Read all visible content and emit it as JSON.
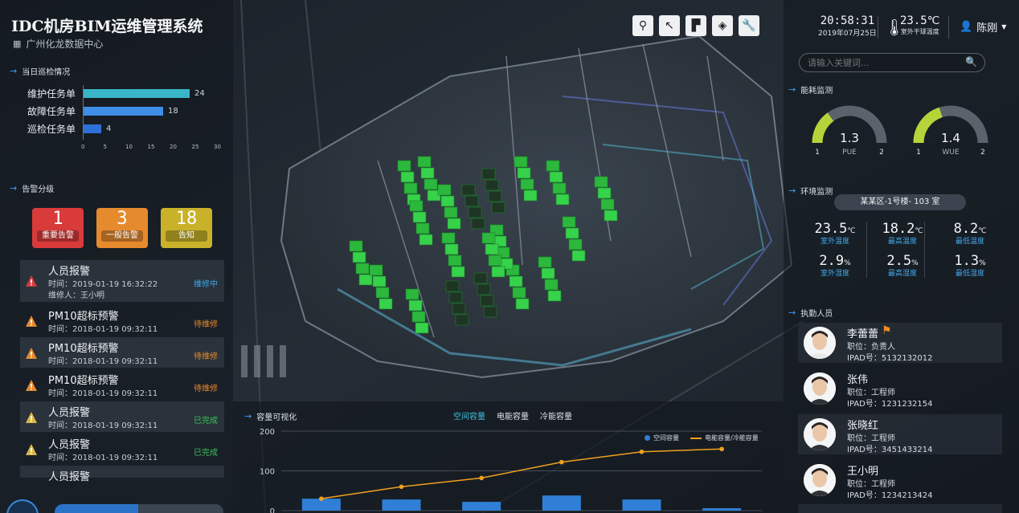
{
  "header": {
    "title": "IDC机房BIM运维管理系统",
    "subtitle": "广州化龙数据中心",
    "time": "20:58:31",
    "date": "2019年07月25日",
    "temperature": "23.5℃",
    "temperature_label": "室外干球温度",
    "user": "陈刚"
  },
  "toolbar": {
    "icons": [
      "location-icon",
      "cursor-icon",
      "paint-roller-icon",
      "layers-icon",
      "wrench-icon"
    ]
  },
  "search": {
    "placeholder": "请输入关键词..."
  },
  "patrol": {
    "title": "当日巡检情况",
    "bars": [
      {
        "label": "维护任务单",
        "value": 24,
        "color": "#39b6c8"
      },
      {
        "label": "故障任务单",
        "value": 18,
        "color": "#3f8ee6"
      },
      {
        "label": "巡检任务单",
        "value": 4,
        "color": "#2f6fd8"
      }
    ],
    "ticks": [
      "0",
      "5",
      "10",
      "15",
      "20",
      "25",
      "30"
    ]
  },
  "alarm_levels": {
    "title": "告警分级",
    "items": [
      {
        "count": "1",
        "label": "重要告警",
        "color": "#d93a3a"
      },
      {
        "count": "3",
        "label": "一般告警",
        "color": "#e68a2e"
      },
      {
        "count": "18",
        "label": "告知",
        "color": "#c9b22a"
      }
    ]
  },
  "alarms": [
    {
      "title": "人员报警",
      "time": "时间：2019-01-19 16:32:22",
      "extra": "维修人：王小明",
      "status": "维修中",
      "status_color": "#3fa8e6",
      "icon_color": "#d93a3a"
    },
    {
      "title": "PM10超标预警",
      "time": "时间：2018-01-19 09:32:11",
      "status": "待维修",
      "status_color": "#e68a2e",
      "icon_color": "#e68a2e"
    },
    {
      "title": "PM10超标预警",
      "time": "时间：2018-01-19 09:32:11",
      "status": "待维修",
      "status_color": "#e68a2e",
      "icon_color": "#e68a2e"
    },
    {
      "title": "PM10超标预警",
      "time": "时间：2018-01-19 09:32:11",
      "status": "待维修",
      "status_color": "#e68a2e",
      "icon_color": "#e68a2e"
    },
    {
      "title": "人员报警",
      "time": "时间：2018-01-19 09:32:11",
      "status": "已完成",
      "status_color": "#3cc05a",
      "icon_color": "#d9b84a"
    },
    {
      "title": "人员报警",
      "time": "时间：2018-01-19 09:32:11",
      "status": "已完成",
      "status_color": "#3cc05a",
      "icon_color": "#d9b84a"
    },
    {
      "title": "人员报警"
    }
  ],
  "capacity": {
    "title": "容量可视化",
    "tabs": [
      "空间容量",
      "电能容量",
      "冷能容量"
    ],
    "active_tab": 0,
    "legend": [
      "空间容量",
      "电能容量/冷能容量"
    ],
    "y_ticks": [
      "200",
      "100",
      "0"
    ]
  },
  "chart_data": {
    "type": "bar",
    "series": [
      {
        "name": "空间容量",
        "type": "bar",
        "values": [
          30,
          28,
          22,
          38,
          28,
          6
        ]
      },
      {
        "name": "电能容量/冷能容量",
        "type": "line",
        "values": [
          30,
          60,
          82,
          122,
          148,
          155
        ]
      }
    ],
    "ylim": [
      0,
      200
    ],
    "y_ticks": [
      0,
      100,
      200
    ],
    "colors": {
      "bar": "#2f7fd6",
      "line": "#f0a020"
    }
  },
  "energy": {
    "title": "能耗监测",
    "gauges": [
      {
        "value": "1.3",
        "label": "PUE",
        "min": "1",
        "max": "2",
        "fraction": 0.3
      },
      {
        "value": "1.4",
        "label": "WUE",
        "min": "1",
        "max": "2",
        "fraction": 0.4
      }
    ]
  },
  "environment": {
    "title": "环境监测",
    "location": "某某区-1号楼- 103 室",
    "values": [
      {
        "value": "23.5",
        "unit": "℃",
        "label": "室外温度"
      },
      {
        "value": "18.2",
        "unit": "℃",
        "label": "最高温度"
      },
      {
        "value": "8.2",
        "unit": "℃",
        "label": "最低温度"
      },
      {
        "value": "2.9",
        "unit": "%",
        "label": "室外湿度"
      },
      {
        "value": "2.5",
        "unit": "%",
        "label": "最高湿度"
      },
      {
        "value": "1.3",
        "unit": "%",
        "label": "最低湿度"
      }
    ]
  },
  "staff": {
    "title": "执勤人员",
    "members": [
      {
        "name": "李蕾蕾",
        "role": "职位：负责人",
        "ipad": "IPAD号：5132132012",
        "leader": true
      },
      {
        "name": "张伟",
        "role": "职位：工程师",
        "ipad": "IPAD号：1231232154"
      },
      {
        "name": "张晓红",
        "role": "职位：工程师",
        "ipad": "IPAD号：3451433214"
      },
      {
        "name": "王小明",
        "role": "职位：工程师",
        "ipad": "IPAD号：1234213424"
      }
    ]
  },
  "colors": {
    "accent": "#3aa0ff",
    "server_green": "#2fc63f",
    "background": "#14191f"
  }
}
